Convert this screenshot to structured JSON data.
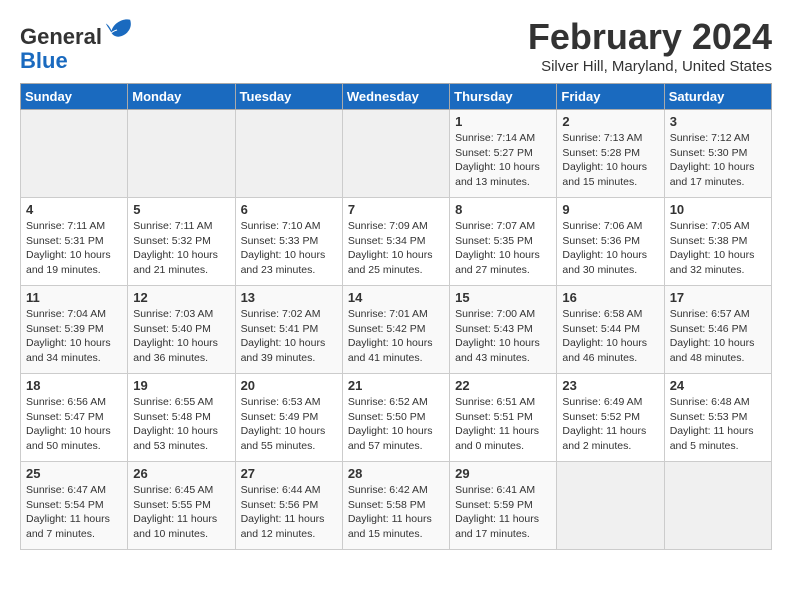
{
  "header": {
    "logo_general": "General",
    "logo_blue": "Blue",
    "title": "February 2024",
    "subtitle": "Silver Hill, Maryland, United States"
  },
  "days_of_week": [
    "Sunday",
    "Monday",
    "Tuesday",
    "Wednesday",
    "Thursday",
    "Friday",
    "Saturday"
  ],
  "weeks": [
    [
      {
        "day": "",
        "info": ""
      },
      {
        "day": "",
        "info": ""
      },
      {
        "day": "",
        "info": ""
      },
      {
        "day": "",
        "info": ""
      },
      {
        "day": "1",
        "info": "Sunrise: 7:14 AM\nSunset: 5:27 PM\nDaylight: 10 hours\nand 13 minutes."
      },
      {
        "day": "2",
        "info": "Sunrise: 7:13 AM\nSunset: 5:28 PM\nDaylight: 10 hours\nand 15 minutes."
      },
      {
        "day": "3",
        "info": "Sunrise: 7:12 AM\nSunset: 5:30 PM\nDaylight: 10 hours\nand 17 minutes."
      }
    ],
    [
      {
        "day": "4",
        "info": "Sunrise: 7:11 AM\nSunset: 5:31 PM\nDaylight: 10 hours\nand 19 minutes."
      },
      {
        "day": "5",
        "info": "Sunrise: 7:11 AM\nSunset: 5:32 PM\nDaylight: 10 hours\nand 21 minutes."
      },
      {
        "day": "6",
        "info": "Sunrise: 7:10 AM\nSunset: 5:33 PM\nDaylight: 10 hours\nand 23 minutes."
      },
      {
        "day": "7",
        "info": "Sunrise: 7:09 AM\nSunset: 5:34 PM\nDaylight: 10 hours\nand 25 minutes."
      },
      {
        "day": "8",
        "info": "Sunrise: 7:07 AM\nSunset: 5:35 PM\nDaylight: 10 hours\nand 27 minutes."
      },
      {
        "day": "9",
        "info": "Sunrise: 7:06 AM\nSunset: 5:36 PM\nDaylight: 10 hours\nand 30 minutes."
      },
      {
        "day": "10",
        "info": "Sunrise: 7:05 AM\nSunset: 5:38 PM\nDaylight: 10 hours\nand 32 minutes."
      }
    ],
    [
      {
        "day": "11",
        "info": "Sunrise: 7:04 AM\nSunset: 5:39 PM\nDaylight: 10 hours\nand 34 minutes."
      },
      {
        "day": "12",
        "info": "Sunrise: 7:03 AM\nSunset: 5:40 PM\nDaylight: 10 hours\nand 36 minutes."
      },
      {
        "day": "13",
        "info": "Sunrise: 7:02 AM\nSunset: 5:41 PM\nDaylight: 10 hours\nand 39 minutes."
      },
      {
        "day": "14",
        "info": "Sunrise: 7:01 AM\nSunset: 5:42 PM\nDaylight: 10 hours\nand 41 minutes."
      },
      {
        "day": "15",
        "info": "Sunrise: 7:00 AM\nSunset: 5:43 PM\nDaylight: 10 hours\nand 43 minutes."
      },
      {
        "day": "16",
        "info": "Sunrise: 6:58 AM\nSunset: 5:44 PM\nDaylight: 10 hours\nand 46 minutes."
      },
      {
        "day": "17",
        "info": "Sunrise: 6:57 AM\nSunset: 5:46 PM\nDaylight: 10 hours\nand 48 minutes."
      }
    ],
    [
      {
        "day": "18",
        "info": "Sunrise: 6:56 AM\nSunset: 5:47 PM\nDaylight: 10 hours\nand 50 minutes."
      },
      {
        "day": "19",
        "info": "Sunrise: 6:55 AM\nSunset: 5:48 PM\nDaylight: 10 hours\nand 53 minutes."
      },
      {
        "day": "20",
        "info": "Sunrise: 6:53 AM\nSunset: 5:49 PM\nDaylight: 10 hours\nand 55 minutes."
      },
      {
        "day": "21",
        "info": "Sunrise: 6:52 AM\nSunset: 5:50 PM\nDaylight: 10 hours\nand 57 minutes."
      },
      {
        "day": "22",
        "info": "Sunrise: 6:51 AM\nSunset: 5:51 PM\nDaylight: 11 hours\nand 0 minutes."
      },
      {
        "day": "23",
        "info": "Sunrise: 6:49 AM\nSunset: 5:52 PM\nDaylight: 11 hours\nand 2 minutes."
      },
      {
        "day": "24",
        "info": "Sunrise: 6:48 AM\nSunset: 5:53 PM\nDaylight: 11 hours\nand 5 minutes."
      }
    ],
    [
      {
        "day": "25",
        "info": "Sunrise: 6:47 AM\nSunset: 5:54 PM\nDaylight: 11 hours\nand 7 minutes."
      },
      {
        "day": "26",
        "info": "Sunrise: 6:45 AM\nSunset: 5:55 PM\nDaylight: 11 hours\nand 10 minutes."
      },
      {
        "day": "27",
        "info": "Sunrise: 6:44 AM\nSunset: 5:56 PM\nDaylight: 11 hours\nand 12 minutes."
      },
      {
        "day": "28",
        "info": "Sunrise: 6:42 AM\nSunset: 5:58 PM\nDaylight: 11 hours\nand 15 minutes."
      },
      {
        "day": "29",
        "info": "Sunrise: 6:41 AM\nSunset: 5:59 PM\nDaylight: 11 hours\nand 17 minutes."
      },
      {
        "day": "",
        "info": ""
      },
      {
        "day": "",
        "info": ""
      }
    ]
  ]
}
